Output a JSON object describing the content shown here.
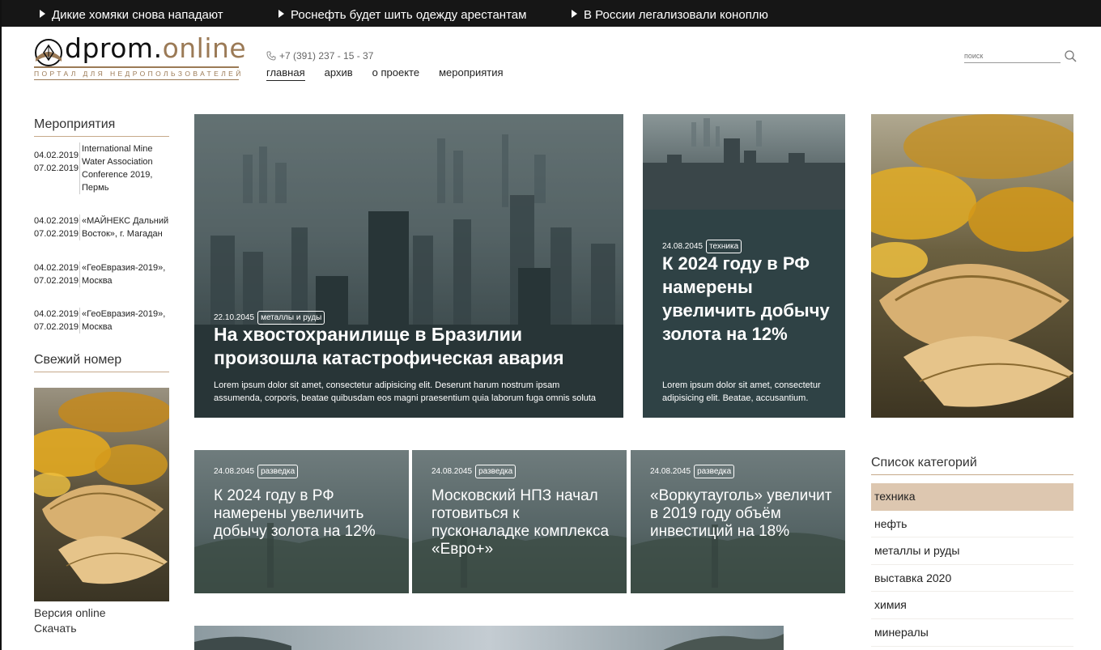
{
  "ticker": [
    "Дикие хомяки снова нападают",
    "Роснефть будет шить одежду арестантам",
    "В России легализовали коноплю"
  ],
  "logo": {
    "name_main": "dprom.",
    "name_accent": "online",
    "subtitle": "ПОРТАЛ ДЛЯ НЕДРОПОЛЬЗОВАТЕЛЕЙ"
  },
  "header": {
    "phone": "+7 (391) 237 - 15 - 37",
    "nav": [
      "главная",
      "архив",
      "о проекте",
      "мероприятия"
    ],
    "search_placeholder": "поиск"
  },
  "events": {
    "title": "Мероприятия",
    "items": [
      {
        "dates": "04.02.2019\n07.02.2019",
        "name": "International Mine Water Association Conference 2019, Пермь"
      },
      {
        "dates": "04.02.2019\n07.02.2019",
        "name": "«МАЙНЕКС Дальний Восток», г. Магадан"
      },
      {
        "dates": "04.02.2019\n07.02.2019",
        "name": "«ГеоЕвразия-2019», Москва"
      },
      {
        "dates": "04.02.2019\n07.02.2019",
        "name": "«ГеоЕвразия-2019», Москва"
      }
    ]
  },
  "issue": {
    "title": "Свежий номер",
    "link_online": "Версия online",
    "link_download": "Скачать"
  },
  "featured": {
    "big": {
      "date": "22.10.2045",
      "tag": "металлы и руды",
      "title": "На хвостохранилище в Бразилии произошла катастрофическая авария",
      "desc": "Lorem ipsum dolor sit amet, consectetur adipisicing elit. Deserunt harum nostrum ipsam assumenda, corporis, beatae quibusdam eos magni praesentium quia laborum fuga omnis soluta"
    },
    "tall": {
      "date": "24.08.2045",
      "tag": "техника",
      "title": "К 2024 году в РФ намерены увеличить добычу золота на 12%",
      "desc": "Lorem ipsum dolor sit amet, consectetur adipisicing elit. Beatae, accusantium."
    }
  },
  "small_cards": [
    {
      "date": "24.08.2045",
      "tag": "разведка",
      "title": "К 2024 году в РФ намерены увеличить добычу золота на 12%"
    },
    {
      "date": "24.08.2045",
      "tag": "разведка",
      "title": "Московский НПЗ начал готовиться к пусконаладке комплекса «Евро+»"
    },
    {
      "date": "24.08.2045",
      "tag": "разведка",
      "title": "«Воркутауголь» увеличит в 2019 году объём инвестиций на 18%"
    }
  ],
  "categories": {
    "title": "Список категорий",
    "items": [
      "техника",
      "нефть",
      "металлы и руды",
      "выставка 2020",
      "химия",
      "минералы"
    ],
    "active": "техника"
  },
  "colors": {
    "accent": "#9b7a56",
    "category_active_bg": "#ddc7b0",
    "ticker_bg": "#161616",
    "tall_card_bg": "#2f4245"
  }
}
